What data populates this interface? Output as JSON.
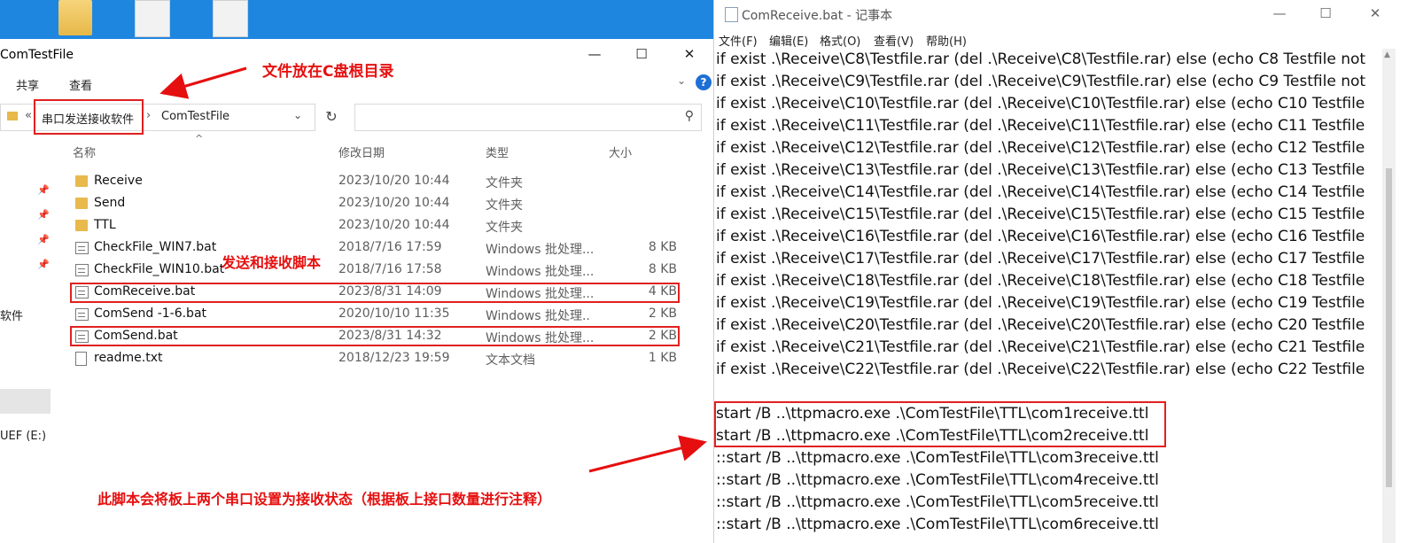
{
  "explorer": {
    "title": "ComTestFile",
    "window_controls": {
      "minimize": "—",
      "maximize": "☐",
      "close": "✕"
    },
    "ribbon": {
      "share": "共享",
      "view": "查看",
      "help": "?"
    },
    "address": {
      "back_chevrons": "«",
      "crumb_parent": "串口发送接收软件",
      "separator": "›",
      "crumb_current": "ComTestFile"
    },
    "columns": {
      "name": "名称",
      "date": "修改日期",
      "type": "类型",
      "size": "大小"
    },
    "nav": {
      "label_software": "软件",
      "label_drive": "UEF (E:)"
    },
    "files": [
      {
        "name": "Receive",
        "date": "2023/10/20 10:44",
        "type": "文件夹",
        "size": "",
        "icon": "folder-icon"
      },
      {
        "name": "Send",
        "date": "2023/10/20 10:44",
        "type": "文件夹",
        "size": "",
        "icon": "folder-icon"
      },
      {
        "name": "TTL",
        "date": "2023/10/20 10:44",
        "type": "文件夹",
        "size": "",
        "icon": "folder-icon"
      },
      {
        "name": "CheckFile_WIN7.bat",
        "date": "2018/7/16 17:59",
        "type": "Windows 批处理...",
        "size": "8 KB",
        "icon": "batch-file-icon"
      },
      {
        "name": "CheckFile_WIN10.bat",
        "date": "2018/7/16 17:58",
        "type": "Windows 批处理...",
        "size": "8 KB",
        "icon": "batch-file-icon"
      },
      {
        "name": "ComReceive.bat",
        "date": "2023/8/31 14:09",
        "type": "Windows 批处理...",
        "size": "4 KB",
        "icon": "batch-file-icon"
      },
      {
        "name": "ComSend -1-6.bat",
        "date": "2020/10/10 11:35",
        "type": "Windows 批处理..",
        "size": "2 KB",
        "icon": "batch-file-icon"
      },
      {
        "name": "ComSend.bat",
        "date": "2023/8/31 14:32",
        "type": "Windows 批处理...",
        "size": "2 KB",
        "icon": "batch-file-icon"
      },
      {
        "name": "readme.txt",
        "date": "2018/12/23 19:59",
        "type": "文本文档",
        "size": "1 KB",
        "icon": "text-file-icon"
      }
    ]
  },
  "notepad": {
    "title": "ComReceive.bat - 记事本",
    "window_controls": {
      "minimize": "—",
      "maximize": "☐",
      "close": "✕"
    },
    "menu": [
      "文件(F)",
      "编辑(E)",
      "格式(O)",
      "查看(V)",
      "帮助(H)"
    ],
    "lines": [
      "if exist .\\Receive\\C8\\Testfile.rar (del .\\Receive\\C8\\Testfile.rar) else (echo C8 Testfile not",
      "if exist .\\Receive\\C9\\Testfile.rar (del .\\Receive\\C9\\Testfile.rar) else (echo C9 Testfile not",
      "if exist .\\Receive\\C10\\Testfile.rar (del .\\Receive\\C10\\Testfile.rar) else (echo C10 Testfile",
      "if exist .\\Receive\\C11\\Testfile.rar (del .\\Receive\\C11\\Testfile.rar) else (echo C11 Testfile",
      "if exist .\\Receive\\C12\\Testfile.rar (del .\\Receive\\C12\\Testfile.rar) else (echo C12 Testfile",
      "if exist .\\Receive\\C13\\Testfile.rar (del .\\Receive\\C13\\Testfile.rar) else (echo C13 Testfile",
      "if exist .\\Receive\\C14\\Testfile.rar (del .\\Receive\\C14\\Testfile.rar) else (echo C14 Testfile",
      "if exist .\\Receive\\C15\\Testfile.rar (del .\\Receive\\C15\\Testfile.rar) else (echo C15 Testfile",
      "if exist .\\Receive\\C16\\Testfile.rar (del .\\Receive\\C16\\Testfile.rar) else (echo C16 Testfile",
      "if exist .\\Receive\\C17\\Testfile.rar (del .\\Receive\\C17\\Testfile.rar) else (echo C17 Testfile",
      "if exist .\\Receive\\C18\\Testfile.rar (del .\\Receive\\C18\\Testfile.rar) else (echo C18 Testfile",
      "if exist .\\Receive\\C19\\Testfile.rar (del .\\Receive\\C19\\Testfile.rar) else (echo C19 Testfile",
      "if exist .\\Receive\\C20\\Testfile.rar (del .\\Receive\\C20\\Testfile.rar) else (echo C20 Testfile",
      "if exist .\\Receive\\C21\\Testfile.rar (del .\\Receive\\C21\\Testfile.rar) else (echo C21 Testfile",
      "if exist .\\Receive\\C22\\Testfile.rar (del .\\Receive\\C22\\Testfile.rar) else (echo C22 Testfile",
      "",
      "start /B ..\\ttpmacro.exe .\\ComTestFile\\TTL\\com1receive.ttl",
      "start /B ..\\ttpmacro.exe .\\ComTestFile\\TTL\\com2receive.ttl",
      "::start /B ..\\ttpmacro.exe .\\ComTestFile\\TTL\\com3receive.ttl",
      "::start /B ..\\ttpmacro.exe .\\ComTestFile\\TTL\\com4receive.ttl",
      "::start /B ..\\ttpmacro.exe .\\ComTestFile\\TTL\\com5receive.ttl",
      "::start /B ..\\ttpmacro.exe .\\ComTestFile\\TTL\\com6receive.ttl"
    ]
  },
  "annotations": {
    "root_dir_note": "文件放在C盘根目录",
    "scripts_note": "发送和接收脚本",
    "ports_note": "此脚本会将板上两个串口设置为接收状态（根据板上接口数量进行注释）",
    "color": "#e60f0f"
  }
}
